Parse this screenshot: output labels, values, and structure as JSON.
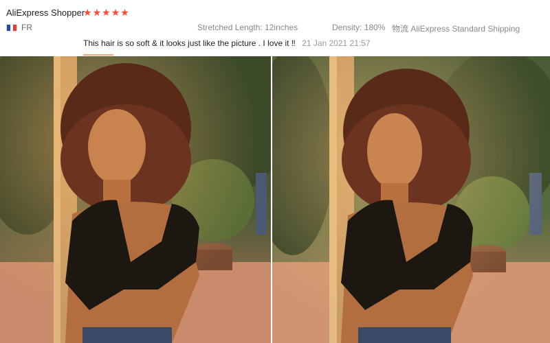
{
  "review": {
    "reviewer_name": "AliExpress Shopper",
    "rating": 5,
    "country_code": "FR",
    "flag_colors": [
      "#1f4aa8",
      "#ffffff",
      "#e63b3b"
    ],
    "sku": {
      "length_label": "Stretched Length:",
      "length_value": "12inches",
      "density_label": "Density:",
      "density_value": "180%",
      "shipping_label": "物流",
      "shipping_value": "AliExpress Standard Shipping"
    },
    "text": "This hair is so soft & it looks just like the picture . I love it ‼",
    "date": "21 Jan 2021 21:57"
  },
  "photos": [
    {
      "id": "photo-1"
    },
    {
      "id": "photo-2"
    }
  ],
  "colors": {
    "star": "#ff4a33",
    "accent_underline": "#f0a878"
  }
}
